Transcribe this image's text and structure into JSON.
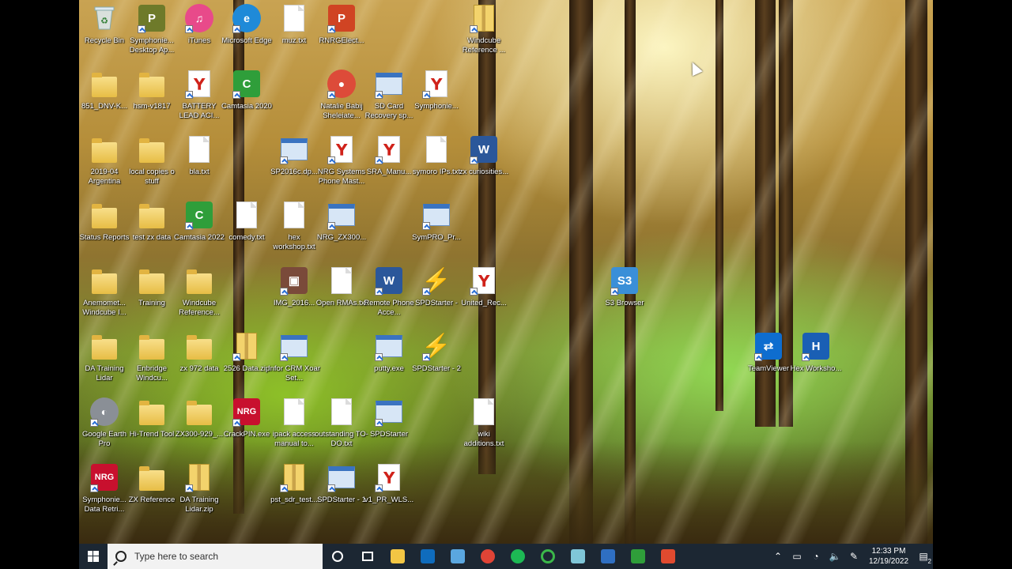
{
  "icons": [
    {
      "label": "Recycle Bin",
      "type": "recycle",
      "icon": "recycle-bin-icon"
    },
    {
      "label": "Symphonie... Desktop Ap...",
      "type": "tile",
      "color": "#6e7a2a",
      "text": "P",
      "icon": "symphonie-desktop-icon"
    },
    {
      "label": "iTunes",
      "type": "round",
      "color": "#e84a8a",
      "text": "♫",
      "icon": "itunes-icon"
    },
    {
      "label": "Microsoft Edge",
      "type": "round",
      "color": "#1f8ad8",
      "text": "e",
      "icon": "edge-icon"
    },
    {
      "label": "muz.txt",
      "type": "doc",
      "icon": "text-file-icon"
    },
    {
      "label": "RNRGElect...",
      "type": "tile",
      "color": "#d04423",
      "text": "P",
      "icon": "powerpoint-icon"
    },
    {
      "label": "Windcube Reference ...",
      "type": "zip",
      "icon": "zip-folder-icon"
    },
    {
      "label": "851_DNV-K...",
      "type": "folder",
      "icon": "folder-icon"
    },
    {
      "label": "hsm-v1817",
      "type": "folder",
      "icon": "folder-icon"
    },
    {
      "label": "BATTERY LEAD ACI...",
      "type": "pdf",
      "icon": "pdf-icon"
    },
    {
      "label": "Camtasia 2020",
      "type": "tile",
      "color": "#2f9e3a",
      "text": "C",
      "icon": "camtasia-icon"
    },
    {
      "label": "Natalie Babij Sheleiate...",
      "type": "round",
      "color": "#dd4b39",
      "text": "●",
      "icon": "chrome-icon"
    },
    {
      "label": "SD Card Recovery sp...",
      "type": "win",
      "icon": "sd-card-recovery-icon"
    },
    {
      "label": "Symphonie...",
      "type": "pdf",
      "icon": "pdf-icon"
    },
    {
      "label": "2019-04 Argentina",
      "type": "folder",
      "icon": "folder-icon"
    },
    {
      "label": "local copies o stuff",
      "type": "folder",
      "icon": "folder-icon"
    },
    {
      "label": "bla.txt",
      "type": "doc",
      "icon": "text-file-icon"
    },
    {
      "label": "SP2016c.dp...",
      "type": "win",
      "icon": "setup-icon"
    },
    {
      "label": "NRG Systems Phone Mast...",
      "type": "pdf",
      "icon": "pdf-icon"
    },
    {
      "label": "SRA_Manu...",
      "type": "pdf",
      "icon": "pdf-icon"
    },
    {
      "label": "symoro IPs.txt",
      "type": "doc",
      "icon": "text-file-icon"
    },
    {
      "label": "zx curiosities...",
      "type": "tile",
      "color": "#2b579a",
      "text": "W",
      "icon": "word-icon"
    },
    {
      "label": "Status Reports",
      "type": "folder",
      "icon": "folder-icon"
    },
    {
      "label": "test zx data",
      "type": "folder",
      "icon": "folder-icon"
    },
    {
      "label": "Camtasia 2022",
      "type": "tile",
      "color": "#2f9e3a",
      "text": "C",
      "icon": "camtasia-icon"
    },
    {
      "label": "comedy.txt",
      "type": "doc",
      "icon": "text-file-icon"
    },
    {
      "label": "hex workshop.txt",
      "type": "doc",
      "icon": "text-file-icon"
    },
    {
      "label": "NRG_ZX300...",
      "type": "win",
      "icon": "image-file-icon"
    },
    {
      "label": "SymPRO_Pr...",
      "type": "win",
      "icon": "image-file-icon"
    },
    {
      "label": "Anemomet... Windcube I...",
      "type": "folder",
      "icon": "folder-icon"
    },
    {
      "label": "Training",
      "type": "folder",
      "icon": "folder-icon"
    },
    {
      "label": "Windcube Reference...",
      "type": "folder",
      "icon": "folder-icon"
    },
    {
      "label": "IMG_2016...",
      "type": "tile",
      "color": "#7a4a3a",
      "text": "▣",
      "icon": "photo-icon"
    },
    {
      "label": "Open RMAs.txt",
      "type": "doc",
      "icon": "text-file-icon"
    },
    {
      "label": "Remote Phone Acce...",
      "type": "tile",
      "color": "#2b579a",
      "text": "W",
      "icon": "word-icon"
    },
    {
      "label": "SPDStarter -",
      "type": "bolt",
      "icon": "spdstarter-icon"
    },
    {
      "label": "United_Rec...",
      "type": "pdf",
      "icon": "pdf-icon"
    },
    {
      "label": "S3 Browser",
      "type": "tile",
      "color": "#3a8fd8",
      "text": "S3",
      "icon": "s3-browser-icon"
    },
    {
      "label": "DA Training Lidar",
      "type": "folder",
      "icon": "folder-icon"
    },
    {
      "label": "Enbridge Windcu...",
      "type": "folder",
      "icon": "folder-icon"
    },
    {
      "label": "zx 972 data",
      "type": "folder",
      "icon": "folder-icon"
    },
    {
      "label": "2526 Data.zip",
      "type": "zip",
      "icon": "zip-folder-icon"
    },
    {
      "label": "Infor CRM Xoar Set...",
      "type": "win",
      "icon": "network-icon"
    },
    {
      "label": "putty.exe",
      "type": "win",
      "icon": "putty-icon"
    },
    {
      "label": "SPDStarter - 2",
      "type": "bolt",
      "icon": "spdstarter-icon"
    },
    {
      "label": "TeamViewer",
      "type": "tile",
      "color": "#0e6dcf",
      "text": "⇄",
      "icon": "teamviewer-icon"
    },
    {
      "label": "Hex Worksho...",
      "type": "tile",
      "color": "#1a5fb4",
      "text": "H",
      "icon": "hex-workshop-icon"
    },
    {
      "label": "Google Earth Pro",
      "type": "round",
      "color": "#8a8f96",
      "text": "◐",
      "icon": "google-earth-icon"
    },
    {
      "label": "Hi-Trend Tool",
      "type": "folder",
      "icon": "folder-icon"
    },
    {
      "label": "ZX300-929_...",
      "type": "folder",
      "icon": "folder-icon"
    },
    {
      "label": "CrackPIN.exe",
      "type": "tile",
      "color": "#c8102e",
      "text": "NRG",
      "icon": "nrg-icon"
    },
    {
      "label": "ipack access manual to...",
      "type": "doc",
      "icon": "text-file-icon"
    },
    {
      "label": "outstanding TO-DO.txt",
      "type": "doc",
      "icon": "text-file-icon"
    },
    {
      "label": "SPDStarter",
      "type": "win",
      "icon": "window-app-icon"
    },
    {
      "label": "wiki additions.txt",
      "type": "doc",
      "icon": "text-file-icon"
    },
    {
      "label": "Symphonie... Data Retri...",
      "type": "tile",
      "color": "#c8102e",
      "text": "NRG",
      "icon": "nrg-icon"
    },
    {
      "label": "ZX Reference",
      "type": "folder",
      "icon": "folder-icon"
    },
    {
      "label": "DA Training Lidar.zip",
      "type": "zip",
      "icon": "zip-folder-icon"
    },
    {
      "label": "pst_sdr_test...",
      "type": "zip",
      "icon": "zip-folder-icon"
    },
    {
      "label": "SPDStarter - 1",
      "type": "win",
      "icon": "window-app-icon"
    },
    {
      "label": "v1_PR_WLS...",
      "type": "pdf",
      "icon": "pdf-icon"
    }
  ],
  "taskbar": {
    "search_placeholder": "Type here to search",
    "clock_time": "12:33 PM",
    "clock_date": "12/19/2022",
    "notification_count": "2"
  }
}
